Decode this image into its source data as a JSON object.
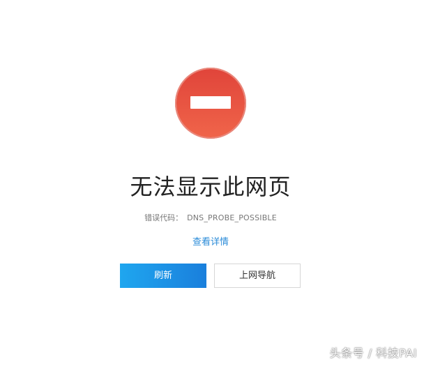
{
  "colors": {
    "error_icon": "#e0443a",
    "primary_button": "#1a8fe3",
    "link": "#2a8bd8"
  },
  "error": {
    "icon": "no-entry-icon",
    "title": "无法显示此网页",
    "code_label": "错误代码：",
    "code_value": "DNS_PROBE_POSSIBLE",
    "details_link": "查看详情"
  },
  "actions": {
    "refresh_label": "刷新",
    "nav_label": "上网导航"
  },
  "watermark": "头条号 / 科技PAI"
}
